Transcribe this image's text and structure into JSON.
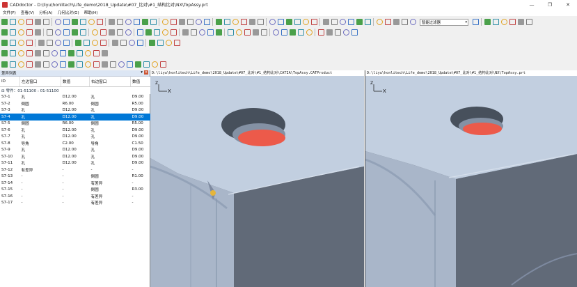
{
  "window": {
    "title": "CADdoctor - D:\\liyu\\honlitech\\Life_demo\\2018_Update\\#07_比对\\#1_结构比对\\NX\\TopAssy.prt",
    "controls": [
      "—",
      "❐",
      "✕"
    ]
  },
  "menu": [
    "文件(F)",
    "查看(V)",
    "分析(A)",
    "几何比对(G)",
    "帮助(H)"
  ],
  "toolbar": {
    "combo_value": "智能过滤器"
  },
  "panel": {
    "title": "差异列表",
    "buttons": [
      "▾ ×"
    ],
    "columns": [
      "ID",
      "左边窗口",
      "数值",
      "右边窗口",
      "数值"
    ],
    "group_label": "⊟ 零件：01-51100 : 01-51100",
    "rows": [
      [
        "S7-1",
        "孔",
        "D12.00",
        "孔",
        "D9.00"
      ],
      [
        "S7-2",
        "倒圆",
        "R6.00",
        "倒圆",
        "R5.00"
      ],
      [
        "S7-3",
        "孔",
        "D12.00",
        "孔",
        "D9.00"
      ],
      [
        "S7-4",
        "孔",
        "D12.00",
        "孔",
        "D9.00"
      ],
      [
        "S7-5",
        "倒圆",
        "R6.00",
        "倒圆",
        "R5.00"
      ],
      [
        "S7-6",
        "孔",
        "D12.00",
        "孔",
        "D9.00"
      ],
      [
        "S7-7",
        "孔",
        "D12.00",
        "孔",
        "D9.00"
      ],
      [
        "S7-8",
        "导角",
        "C2.00",
        "导角",
        "C1.50"
      ],
      [
        "S7-9",
        "孔",
        "D12.00",
        "孔",
        "D9.00"
      ],
      [
        "S7-10",
        "孔",
        "D12.00",
        "孔",
        "D9.00"
      ],
      [
        "S7-11",
        "孔",
        "D12.00",
        "孔",
        "D9.00"
      ],
      [
        "S7-12",
        "有差异",
        "-",
        "-",
        "-"
      ],
      [
        "S7-13",
        "-",
        "-",
        "倒圆",
        "R1.00"
      ],
      [
        "S7-14",
        "-",
        "-",
        "有差异",
        "-"
      ],
      [
        "S7-15",
        "-",
        "-",
        "倒圆",
        "R3.00"
      ],
      [
        "S7-16",
        "-",
        "-",
        "有差异",
        "-"
      ],
      [
        "S7-17",
        "-",
        "-",
        "有差异",
        "-"
      ]
    ],
    "selected_row": 3
  },
  "viewports": {
    "left_path": "D:\\liyu\\honlitech\\Life_demo\\2018_Update\\#07_比对\\#1_结构比对\\CATIA\\TopAssy.CATProduct",
    "right_path": "D:\\liyu\\honlitech\\Life_demo\\2018_Update\\#07_比对\\#1_结构比对\\NX\\TopAssy.prt",
    "axis_x": "X",
    "axis_z": "Z"
  },
  "colors": {
    "selection": "#0078d7",
    "hole_highlight": "#ec5a4a",
    "model_face": "#c2cfe0"
  }
}
